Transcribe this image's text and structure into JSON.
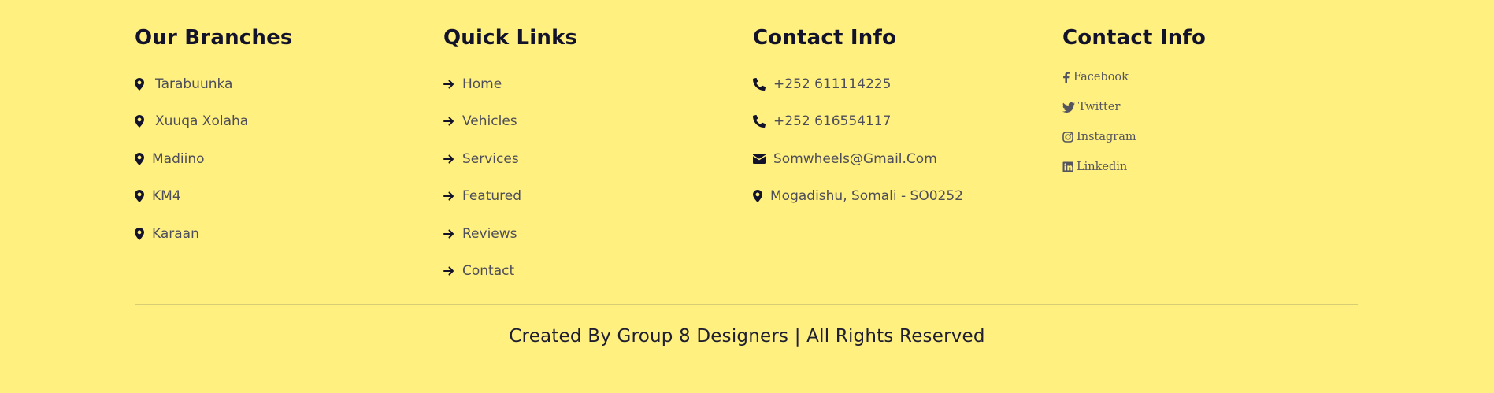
{
  "branches": {
    "title": "Our Branches",
    "items": [
      {
        "label": "Tarabuunka",
        "icon": "map-marker-icon"
      },
      {
        "label": "Xuuqa Xolaha",
        "icon": "map-marker-icon"
      },
      {
        "label": "Madiino",
        "icon": "map-marker-icon"
      },
      {
        "label": "KM4",
        "icon": "map-marker-icon"
      },
      {
        "label": "Karaan",
        "icon": "map-marker-icon"
      }
    ]
  },
  "quick_links": {
    "title": "Quick Links",
    "items": [
      {
        "label": "Home",
        "icon": "arrow-right-icon"
      },
      {
        "label": "Vehicles",
        "icon": "arrow-right-icon"
      },
      {
        "label": "Services",
        "icon": "arrow-right-icon"
      },
      {
        "label": "Featured",
        "icon": "arrow-right-icon"
      },
      {
        "label": "Reviews",
        "icon": "arrow-right-icon"
      },
      {
        "label": "Contact",
        "icon": "arrow-right-icon"
      }
    ]
  },
  "contact_info": {
    "title": "Contact Info",
    "items": [
      {
        "label": "+252 611114225",
        "icon": "phone-icon"
      },
      {
        "label": "+252 616554117",
        "icon": "phone-icon"
      },
      {
        "label": "Somwheels@Gmail.Com",
        "icon": "envelope-icon"
      },
      {
        "label": "Mogadishu, Somali - SO0252",
        "icon": "map-marker-icon"
      }
    ]
  },
  "social": {
    "title": "Contact Info",
    "items": [
      {
        "label": "Facebook",
        "icon": "facebook-icon"
      },
      {
        "label": "Twitter",
        "icon": "twitter-icon"
      },
      {
        "label": "Instagram",
        "icon": "instagram-icon"
      },
      {
        "label": "Linkedin",
        "icon": "linkedin-icon"
      }
    ]
  },
  "footer": {
    "credit": "Created By Group 8 Designers | All Rights Reserved"
  },
  "colors": {
    "background": "#fff07f",
    "heading": "#12122a",
    "text": "#4e4e5a",
    "icon": "#12122a"
  }
}
